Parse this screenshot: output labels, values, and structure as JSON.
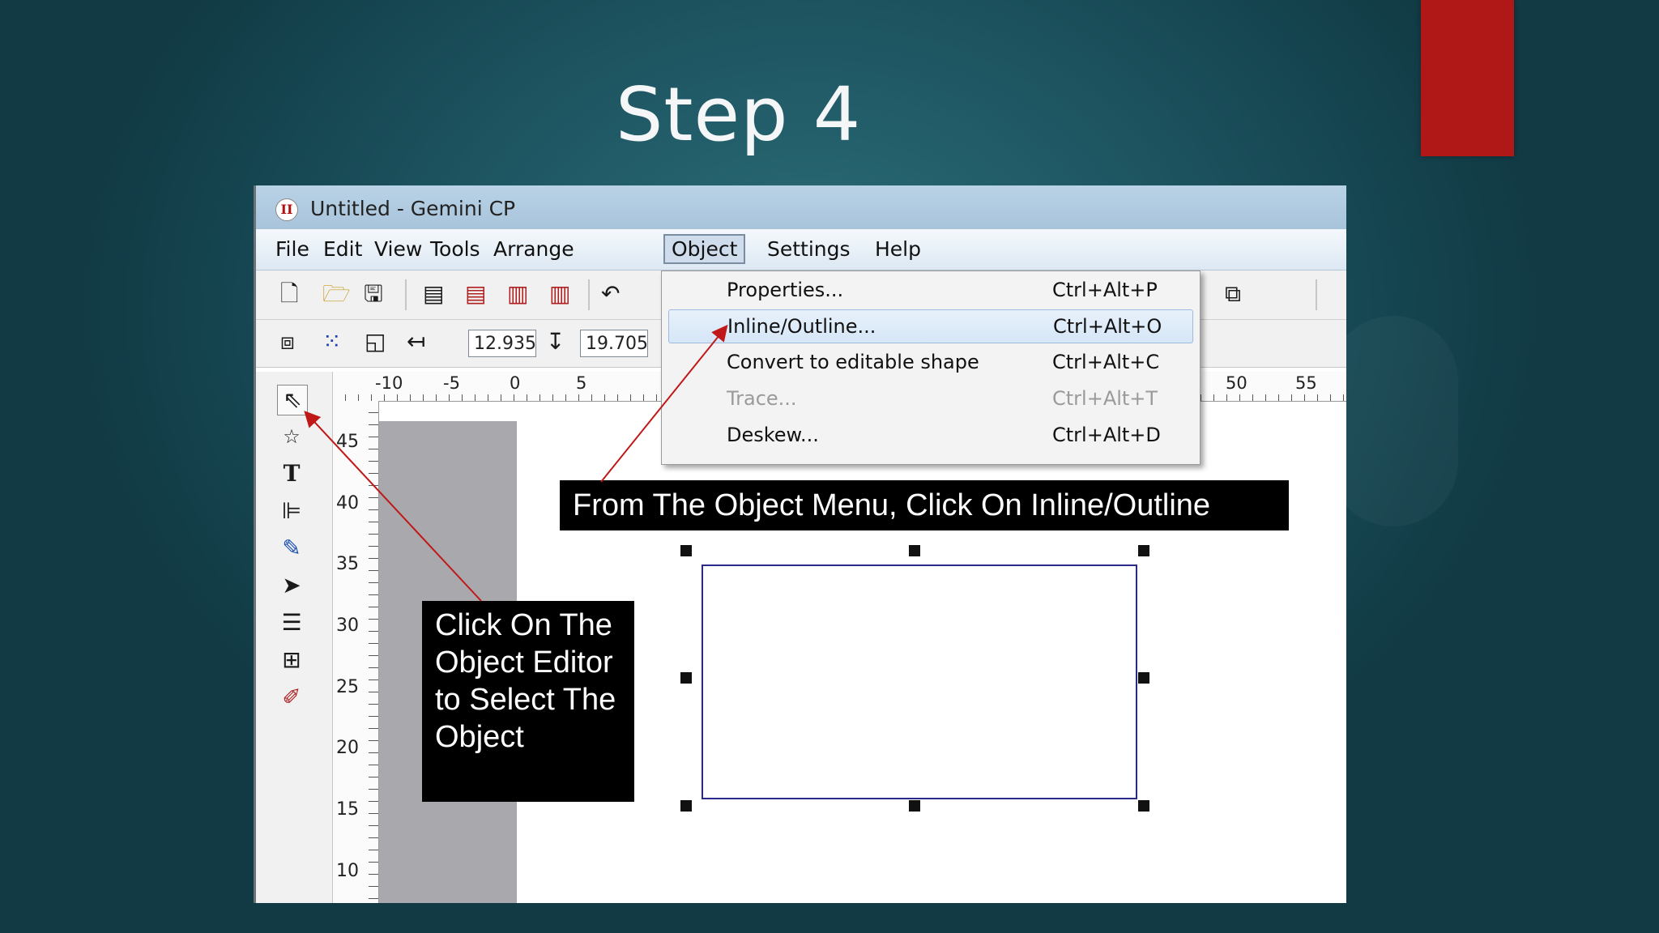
{
  "slide": {
    "title": "Step 4"
  },
  "window": {
    "title": "Untitled - Gemini CP",
    "menu": [
      "File",
      "Edit",
      "View",
      "Tools",
      "Arrange",
      "Object",
      "Settings",
      "Help"
    ],
    "active_menu": "Object"
  },
  "toolbar2": {
    "x_value": "12.935",
    "y_value": "19.705"
  },
  "object_menu": {
    "items": [
      {
        "label": "Properties...",
        "shortcut": "Ctrl+Alt+P",
        "state": "normal"
      },
      {
        "label": "Inline/Outline...",
        "shortcut": "Ctrl+Alt+O",
        "state": "highlighted"
      },
      {
        "label": "Convert to editable shape",
        "shortcut": "Ctrl+Alt+C",
        "state": "normal"
      },
      {
        "label": "Trace...",
        "shortcut": "Ctrl+Alt+T",
        "state": "disabled"
      },
      {
        "label": "Deskew...",
        "shortcut": "Ctrl+Alt+D",
        "state": "normal"
      }
    ]
  },
  "rulers": {
    "top": [
      "-10",
      "-5",
      "0",
      "5",
      "50",
      "55"
    ],
    "left": [
      "45",
      "40",
      "35",
      "30",
      "25",
      "20",
      "15",
      "10"
    ]
  },
  "callouts": {
    "top": "From The Object Menu, Click On Inline/Outline",
    "left": "Click On The Object Editor to Select The Object"
  },
  "colors": {
    "accent_red": "#b01717",
    "background": "#1f5864",
    "menu_highlight": "#d5e6f7"
  },
  "icons": {
    "toolbox": [
      "pointer-arrow-icon",
      "shapes-icon",
      "text-icon",
      "align-icon",
      "pen-icon",
      "node-edit-icon",
      "lines-icon",
      "grid-icon",
      "eyedropper-icon"
    ]
  }
}
